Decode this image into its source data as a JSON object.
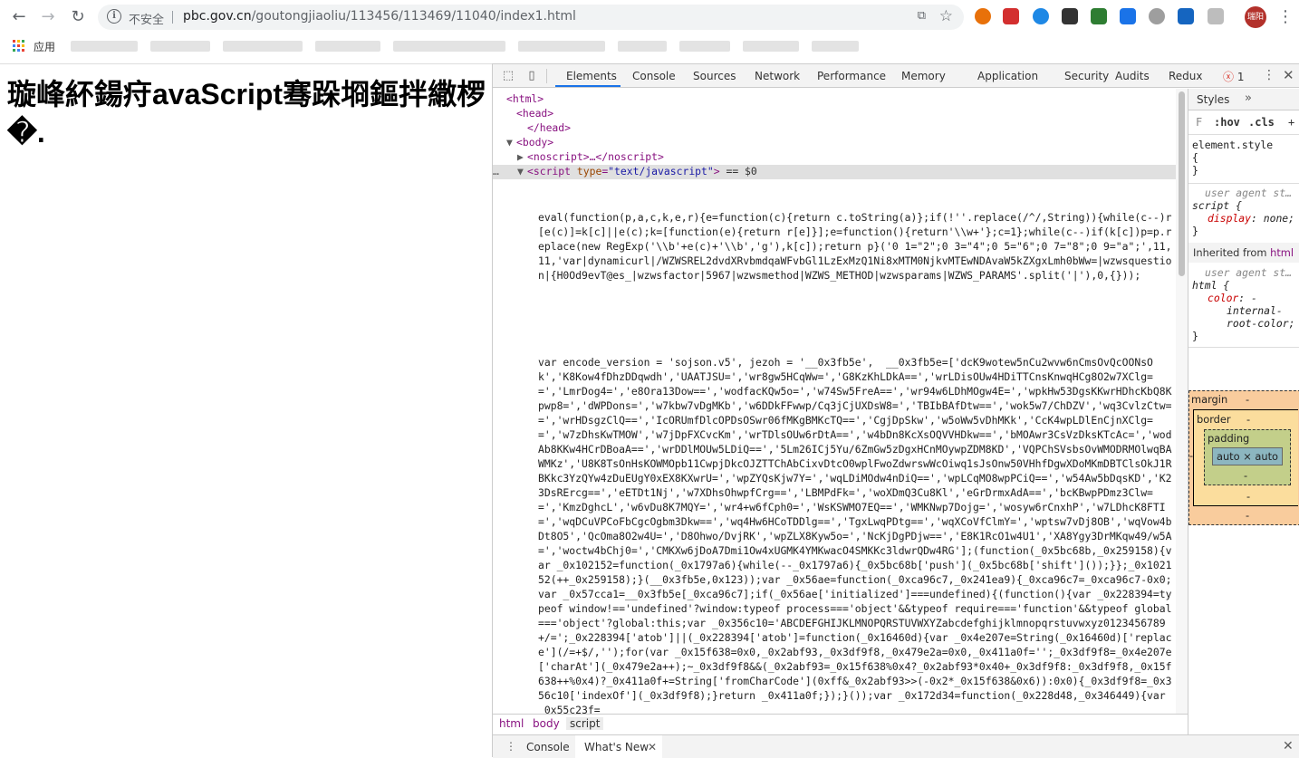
{
  "browser": {
    "insecure_label": "不安全",
    "url_host": "pbc.gov.cn",
    "url_path": "/goutongjiaoliu/113456/113469/11040/index1.html",
    "avatar_text": "瑞阳",
    "apps_label": "应用",
    "extension_colors": [
      "#e8710a",
      "#d32f2f",
      "#1e88e5",
      "#333333",
      "#2e7d32",
      "#1a73e8",
      "#9e9e9e",
      "#1565c0",
      "#bdbdbd"
    ]
  },
  "page": {
    "heading": "璇峰紑鍚疛avaScript骞跺埛鏂拌繖椤�."
  },
  "devtools": {
    "tabs": [
      "Elements",
      "Console",
      "Sources",
      "Network",
      "Performance",
      "Memory",
      "Application",
      "Security",
      "Audits",
      "Redux"
    ],
    "active_tab": "Elements",
    "error_count": "1",
    "dom": {
      "html_open": "<html>",
      "head_open": "<head>",
      "head_close": "</head>",
      "body_open": "<body>",
      "noscript": "<noscript>…</noscript>",
      "script_tag": "script",
      "script_attr": "type",
      "script_attr_val": "\"text/javascript\"",
      "selected_marker": "== $0"
    },
    "script_code_1": "eval(function(p,a,c,k,e,r){e=function(c){return c.toString(a)};if(!''.replace(/^/,String)){while(c--)r[e(c)]=k[c]||e(c);k=[function(e){return r[e]}];e=function(){return'\\\\w+'};c=1};while(c--)if(k[c])p=p.replace(new RegExp('\\\\b'+e(c)+'\\\\b','g'),k[c]);return p}('0 1=\"2\";0 3=\"4\";0 5=\"6\";0 7=\"8\";0 9=\"a\";',11,11,'var|dynamicurl|/WZWSREL2dvdXRvbmdqaWFvbGl1LzExMzQ1Ni8xMTM0NjkvMTEwNDAvaW5kZXgxLmh0bWw=|wzwsquestion|{H0Od9evT@es_|wzwsfactor|5967|wzwsmethod|WZWS_METHOD|wzwsparams|WZWS_PARAMS'.split('|'),0,{}));",
    "script_code_2": "var encode_version = 'sojson.v5', jezoh = '__0x3fb5e',  __0x3fb5e=['dcK9wotew5nCu2wvw6nCmsOvQcOONsOk','K8Kow4fDhzDDqwdh','UAATJSU=','wr8gw5HCqWw=','G8KzKhLDkA==','wrLDisOUw4HDiTTCnsKnwqHCg8O2w7XClg==','LmrDog4=','e8Ora13Dow==','wodfacKQw5o=','w74Sw5FreA==','wr94w6LDhMOgw4E=','wpkHw53DgsKKwrHDhcKbQ8Kpwp8=','dWPDons=','w7kbw7vDgMKb','w6DDkFFwwp/Cq3jCjUXDsW8=','TBIbBAfDtw==','wok5w7/ChDZV','wq3CvlzCtw==','wrHDsgzClQ==','IcORUmfDlcOPDsOSwr06fMKgBMKcTQ==','CgjDpSkw','w5oWw5vDhMKk','CcK4wpLDlEnCjnXClg==','w7zDhsKwTMOW','w7jDpFXCvcKm','wrTDlsOUw6rDtA==','w4bDn8KcXsOQVVHDkw==','bMOAwr3CsVzDksKTcAc=','wodAb8KKw4HCrDBoaA==','wrDDlMOUw5LDiQ==','5Lm26ICj5Yu/6ZmGw5zDgxHCnMOywpZDM8KD','VQPChSVsbsOvWMODRMOlwqBAWMKz','U8K8TsOnHsKOWMOpb11CwpjDkcOJZTTChAbCixvDtcO0wplFwoZdwrswWcOiwq1sJsOnw50VHhfDgwXDoMKmDBTClsOkJ1RBKkc3YzQYw4zDuEUgY0xEX8KXwrU=','wpZYQsKjw7Y=','wqLDiMOdw4nDiQ==','wpLCqMO8wpPCiQ==','w54Aw5bDqsKD','K23DsRErcg==','eETDt1Nj','w7XDhsOhwpfCrg==','LBMPdFk=','woXDmQ3Cu8Kl','eGrDrmxAdA==','bcKBwpPDmz3Clw==','KmzDghcL','w6vDu8K7MQY=','wr4+w6fCph0=','WsKSWMO7EQ==','WMKNwp7Dojg=','wosyw6rCnxhP','w7LDhcK8FTI=','wqDCuVPCoFbCgcOgbm3Dkw==','wq4Hw6HCoTDDlg==','TgxLwqPDtg==','wqXCoVfClmY=','wptsw7vDj8OB','wqVow4bDt8O5','QcOma8O2w4U=','D8Ohwo/DvjRK','wpZLX8Kyw5o=','NcKjDgPDjw==','E8K1RcO1w4U1','XA8Ygy3DrMKqw49/w5A=','woctw4bChj0=','CMKXw6jDoA7Dmi1Ow4xUGMK4YMKwacO4SMKKc3ldwrQDw4RG'];(function(_0x5bc68b,_0x259158){var _0x102152=function(_0x1797a6){while(--_0x1797a6){_0x5bc68b['push'](_0x5bc68b['shift']());}};_0x102152(++_0x259158);}(__0x3fb5e,0x123));var _0x56ae=function(_0xca96c7,_0x241ea9){_0xca96c7=_0xca96c7-0x0;var _0x57cca1=__0x3fb5e[_0xca96c7];if(_0x56ae['initialized']===undefined){(function(){var _0x228394=typeof window!=='undefined'?window:typeof process==='object'&&typeof require==='function'&&typeof global==='object'?global:this;var _0x356c10='ABCDEFGHIJKLMNOPQRSTUVWXYZabcdefghijklmnopqrstuvwxyz0123456789+/=';_0x228394['atob']||(_0x228394['atob']=function(_0x16460d){var _0x4e207e=String(_0x16460d)['replace'](/=+$/,'');for(var _0x15f638=0x0,_0x2abf93,_0x3df9f8,_0x479e2a=0x0,_0x411a0f='';_0x3df9f8=_0x4e207e['charAt'](_0x479e2a++);~_0x3df9f8&&(_0x2abf93=_0x15f638%0x4?_0x2abf93*0x40+_0x3df9f8:_0x3df9f8,_0x15f638++%0x4)?_0x411a0f+=String['fromCharCode'](0xff&_0x2abf93>>(-0x2*_0x15f638&0x6)):0x0){_0x3df9f8=_0x356c10['indexOf'](_0x3df9f8);}return _0x411a0f;});}());var _0x172d34=function(_0x228d48,_0x346449){var _0x55c23f=",
    "breadcrumbs": [
      "html",
      "body",
      "script"
    ],
    "drawer_tabs": [
      "Console",
      "What's New"
    ],
    "styles": {
      "tab_title": "Styles",
      "filter_hint": "F",
      "hov": ":hov",
      "cls": ".cls",
      "element_style_sel": "element.style",
      "brace_open": "{",
      "brace_close": "}",
      "ua_label": "user agent st…",
      "rule1_sel": "script {",
      "rule1_prop": "display",
      "rule1_val": ": none;",
      "inherited_label": "Inherited from",
      "inherited_tag": "html",
      "rule2_sel": "html {",
      "rule2_prop": "color",
      "rule2_val": ": -",
      "rule2_val_2": "internal-",
      "rule2_val_3": "root-color;",
      "boxmodel": {
        "margin": "margin",
        "border": "border",
        "padding": "padding",
        "content": "auto × auto",
        "dash": "-"
      }
    }
  }
}
